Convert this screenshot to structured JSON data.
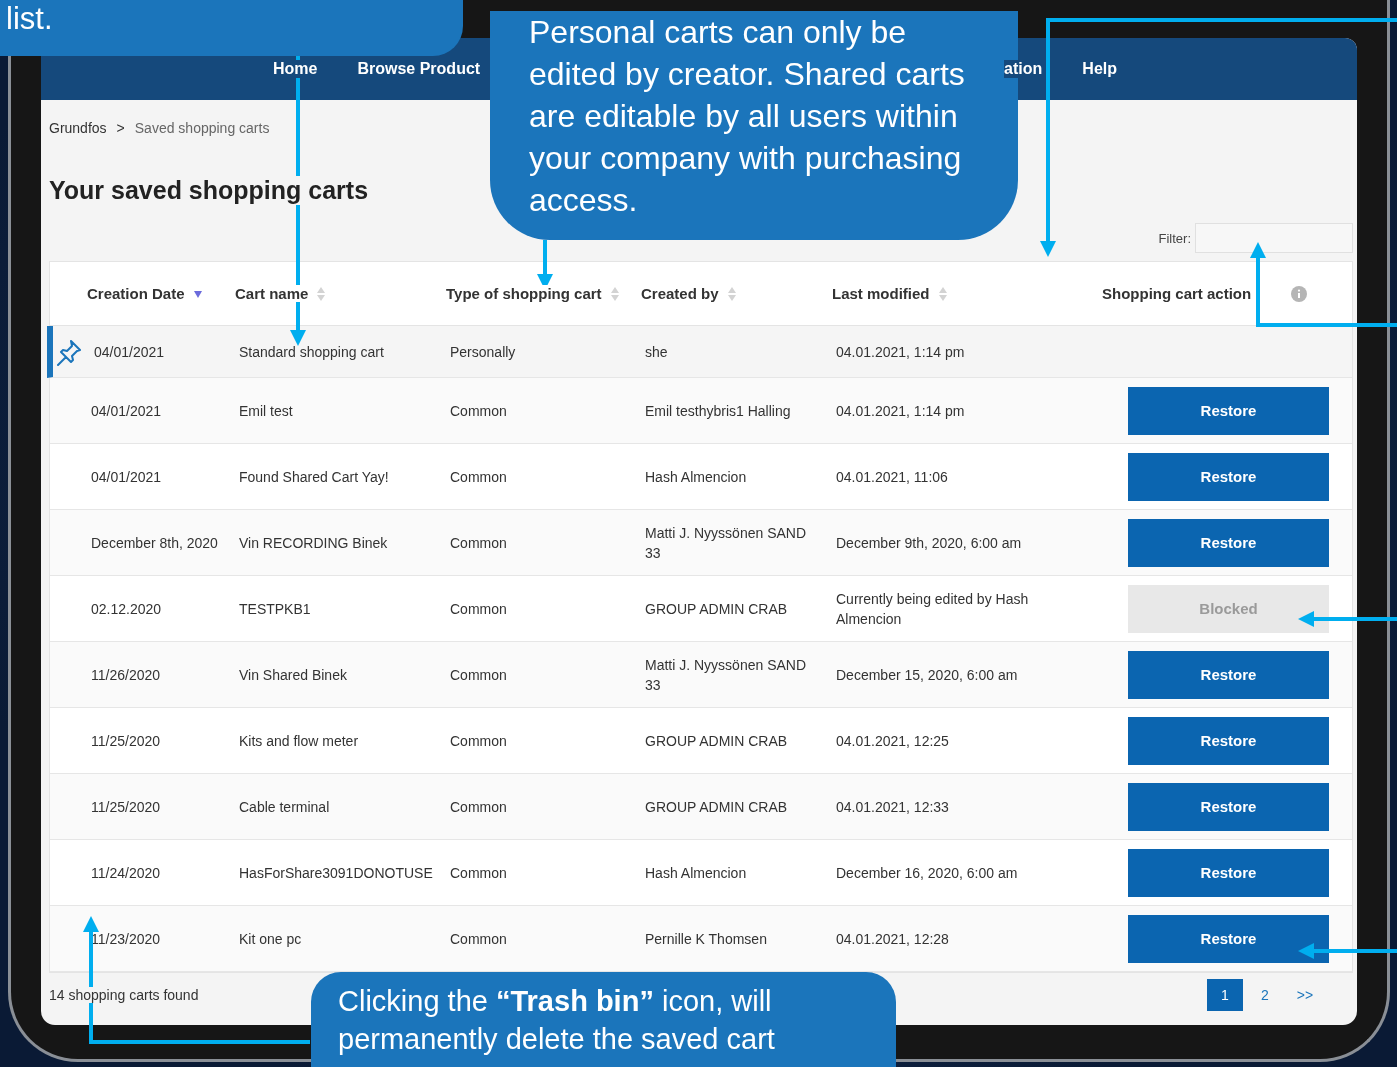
{
  "callouts": [
    {
      "kind": "top",
      "text": "list."
    },
    {
      "kind": "middle",
      "text": "Personal carts can only be edited by creator. Shared carts are editable by all users within your company with purchasing access."
    },
    {
      "kind": "bottom",
      "text": "Clicking the **“Trash bin”** icon, will permanently delete the saved cart"
    }
  ],
  "nav": [
    {
      "label": "Home",
      "kind": "left"
    },
    {
      "label": "Browse Product",
      "kind": "left"
    },
    {
      "label": "ation",
      "kind": "right"
    },
    {
      "label": "Help",
      "kind": "right"
    }
  ],
  "breadcrumb": {
    "items": [
      "Grundfos",
      "Saved shopping carts"
    ],
    "separator": ">"
  },
  "title": "Your saved shopping carts",
  "filter": {
    "label": "Filter:"
  },
  "table": {
    "columns": [
      {
        "label": "Creation Date",
        "kind": "sortable",
        "sorted": true
      },
      {
        "label": "Cart name",
        "kind": "sortable",
        "sorted": false
      },
      {
        "label": "Type of shopping cart",
        "kind": "sortable",
        "sorted": false
      },
      {
        "label": "Created by",
        "kind": "sortable",
        "sorted": false
      },
      {
        "label": "Last modified",
        "kind": "sortable",
        "sorted": false
      },
      {
        "label": "Shopping cart action",
        "kind": "info"
      }
    ],
    "rows": [
      {
        "pinned": true,
        "cells": [
          "04/01/2021",
          "Standard shopping cart",
          "Personally",
          "she",
          "04.01.2021, 1:14 pm"
        ],
        "action": {
          "kind": "none"
        }
      },
      {
        "pinned": false,
        "cells": [
          "04/01/2021",
          "Emil test",
          "Common",
          "Emil testhybris1 Halling",
          "04.01.2021, 1:14 pm"
        ],
        "action": {
          "kind": "restore",
          "label": "Restore"
        }
      },
      {
        "pinned": false,
        "cells": [
          "04/01/2021",
          "Found Shared Cart Yay!",
          "Common",
          "Hash Almencion",
          "04.01.2021, 11:06"
        ],
        "action": {
          "kind": "restore",
          "label": "Restore"
        }
      },
      {
        "pinned": false,
        "cells": [
          "December 8th, 2020",
          "Vin RECORDING Binek",
          "Common",
          "Matti J. Nyyssönen SAND 33",
          "December 9th, 2020, 6:00 am"
        ],
        "action": {
          "kind": "restore",
          "label": "Restore"
        }
      },
      {
        "pinned": false,
        "cells": [
          "02.12.2020",
          "TESTPKB1",
          "Common",
          "GROUP ADMIN CRAB",
          "Currently being edited by Hash Almencion"
        ],
        "action": {
          "kind": "blocked",
          "label": "Blocked"
        }
      },
      {
        "pinned": false,
        "cells": [
          "11/26/2020",
          "Vin Shared Binek",
          "Common",
          "Matti J. Nyyssönen SAND 33",
          "December 15, 2020, 6:00 am"
        ],
        "action": {
          "kind": "restore",
          "label": "Restore"
        }
      },
      {
        "pinned": false,
        "cells": [
          "11/25/2020",
          "Kits and flow meter",
          "Common",
          "GROUP ADMIN CRAB",
          "04.01.2021, 12:25"
        ],
        "action": {
          "kind": "restore",
          "label": "Restore"
        }
      },
      {
        "pinned": false,
        "cells": [
          "11/25/2020",
          "Cable terminal",
          "Common",
          "GROUP ADMIN CRAB",
          "04.01.2021, 12:33"
        ],
        "action": {
          "kind": "restore",
          "label": "Restore"
        }
      },
      {
        "pinned": false,
        "cells": [
          "11/24/2020",
          "HasForShare3091DONOTUSE",
          "Common",
          "Hash Almencion",
          "December 16, 2020, 6:00 am"
        ],
        "action": {
          "kind": "restore",
          "label": "Restore"
        }
      },
      {
        "pinned": false,
        "cells": [
          "11/23/2020",
          "Kit one pc",
          "Common",
          "Pernille K Thomsen",
          "04.01.2021, 12:28"
        ],
        "action": {
          "kind": "restore",
          "label": "Restore"
        }
      }
    ]
  },
  "footer": {
    "count": "14 shopping carts found",
    "pages": [
      {
        "label": "1",
        "selected": true
      },
      {
        "label": "2",
        "selected": false
      }
    ],
    "next": ">>"
  }
}
